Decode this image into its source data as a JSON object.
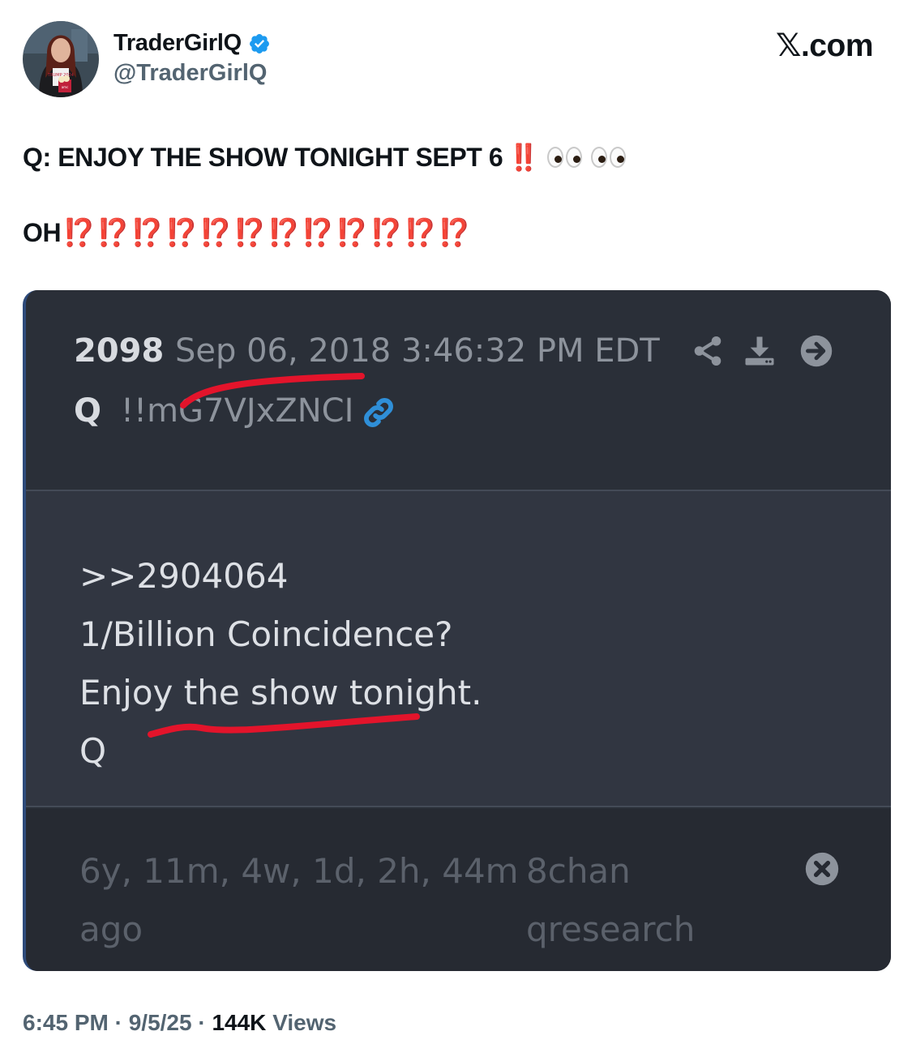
{
  "author": {
    "display_name": "TraderGirlQ",
    "handle": "@TraderGirlQ",
    "verified": true,
    "avatar_text": "TRUMP 2024",
    "avatar_popcorn_text": "amc"
  },
  "brand": {
    "x": "𝕏",
    "suffix": ".com"
  },
  "tweet": {
    "line1_text": "Q: ENJOY THE SHOW TONIGHT SEPT 6",
    "line1_emphasis": "‼️",
    "line1_icon": "eyes-emoji",
    "line2_text": "OH",
    "line2_emphasis": "⁉️⁉️⁉️⁉️⁉️⁉️⁉️⁉️⁉️⁉️⁉️⁉️"
  },
  "qpost": {
    "number": "2098",
    "datetime": "Sep 06, 2018 3:46:32 PM EDT",
    "author": "Q",
    "tripcode": "!!mG7VJxZNCI",
    "body": [
      ">>2904064",
      "1/Billion Coincidence?",
      "Enjoy the show tonight.",
      "Q"
    ],
    "age_line1": "6y, 11m, 4w, 1d, 2h, 44m",
    "age_line2": "ago",
    "source_line1": "8chan",
    "source_line2": "qresearch",
    "icons": [
      "share-icon",
      "download-icon",
      "arrow-right-icon",
      "link-icon",
      "close-icon"
    ]
  },
  "meta": {
    "time": "6:45 PM",
    "sep": "·",
    "date": "9/5/25",
    "views_count": "144K",
    "views_label": "Views"
  },
  "colors": {
    "card_bg": "#2a2f38",
    "card_body_bg": "#313641",
    "annotation_red": "#e3142b",
    "verified_blue": "#1d9bf0",
    "link_blue": "#2f8fd8"
  }
}
